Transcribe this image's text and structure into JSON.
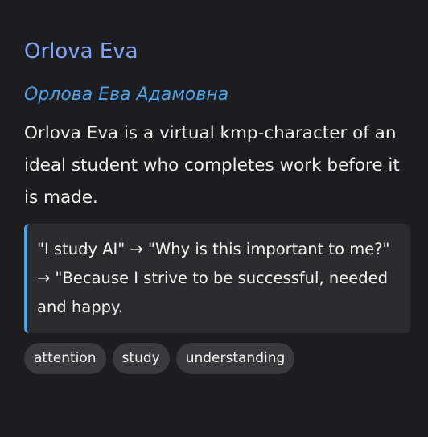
{
  "profile": {
    "name": "Orlova Eva",
    "native_name": "Орлова Ева Адамовна",
    "description": "Orlova Eva is a virtual kmp-character of an ideal student who completes work before it is made.",
    "quote": "\"I study AI\" → \"Why is this important to me?\" → \"Because I strive to be successful, needed and happy.",
    "tags": [
      "attention",
      "study",
      "understanding"
    ]
  },
  "colors": {
    "background": "#1d1d1f",
    "name": "#7fa6ff",
    "native_name": "#4da3e6",
    "quote_accent": "#4aa3e8",
    "quote_background": "#2c2c2e",
    "tag_background": "#3a3a3c"
  }
}
